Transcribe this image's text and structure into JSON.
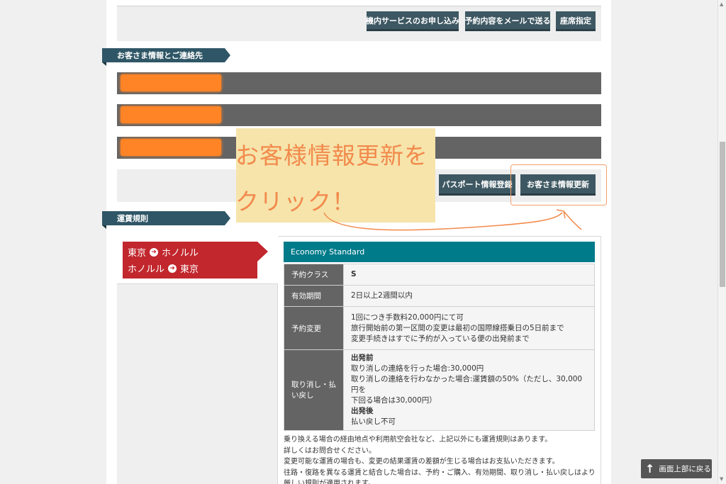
{
  "toolbar": {
    "inflight_service": "機内サービスのお申し込み",
    "email_reservation": "予約内容をメールで送る",
    "seat_selection": "座席指定"
  },
  "customer_section": {
    "title": "お客さま情報とご連絡先"
  },
  "actions": {
    "passport_register": "パスポート情報登録",
    "update_customer": "お客さま情報更新"
  },
  "annotation": {
    "line1": "お客様情報更新を",
    "line2": "クリック！"
  },
  "fare_section": {
    "title": "運賃規則",
    "route1_from": "東京",
    "route1_to": "ホノルル",
    "route2_from": "ホノルル",
    "route2_to": "東京",
    "fare_name": "Economy Standard",
    "rows": [
      {
        "label": "予約クラス",
        "value": "S"
      },
      {
        "label": "有効期間",
        "value": "2日以上2週間以内"
      },
      {
        "label": "予約変更",
        "lines": [
          "1回につき手数料20,000円にて可",
          "旅行開始前の第一区間の変更は最初の国際線搭乗日の5日前まで",
          "変更手続きはすでに予約が入っている便の出発前まで"
        ]
      },
      {
        "label_line1": "取り消し・払",
        "label_line2": "い戻し",
        "before_label": "出発前",
        "before_line1": "取り消しの連絡を行った場合:30,000円",
        "before_line2": "取り消しの連絡を行わなかった場合:運賃額の50%（ただし、30,000円を",
        "before_line3": "下回る場合は30,000円）",
        "after_label": "出発後",
        "after_line1": "払い戻し不可"
      }
    ],
    "notes": [
      "乗り換える場合の経由地点や利用航空会社など、上記以外にも運賃規則はあります。",
      "詳しくはお問合せください。",
      "変更可能な運賃の場合も、変更の結果運賃の差額が生じる場合はお支払いただきます。",
      "往路・復路を異なる運賃と結合した場合は、予約・ご購入、有効期間、取り消し・払い戻しはより",
      "厳しい規則が適用されます。"
    ]
  },
  "back_to_top": "画面上部に戻る",
  "colors": {
    "button": "#3e5863",
    "section_tag": "#2f5666",
    "route": "#c1272d",
    "fare_header": "#007b8a",
    "redaction": "#ff8426",
    "annotation_bg": "#f6e4ab",
    "annotation_text": "#f28a4c"
  }
}
